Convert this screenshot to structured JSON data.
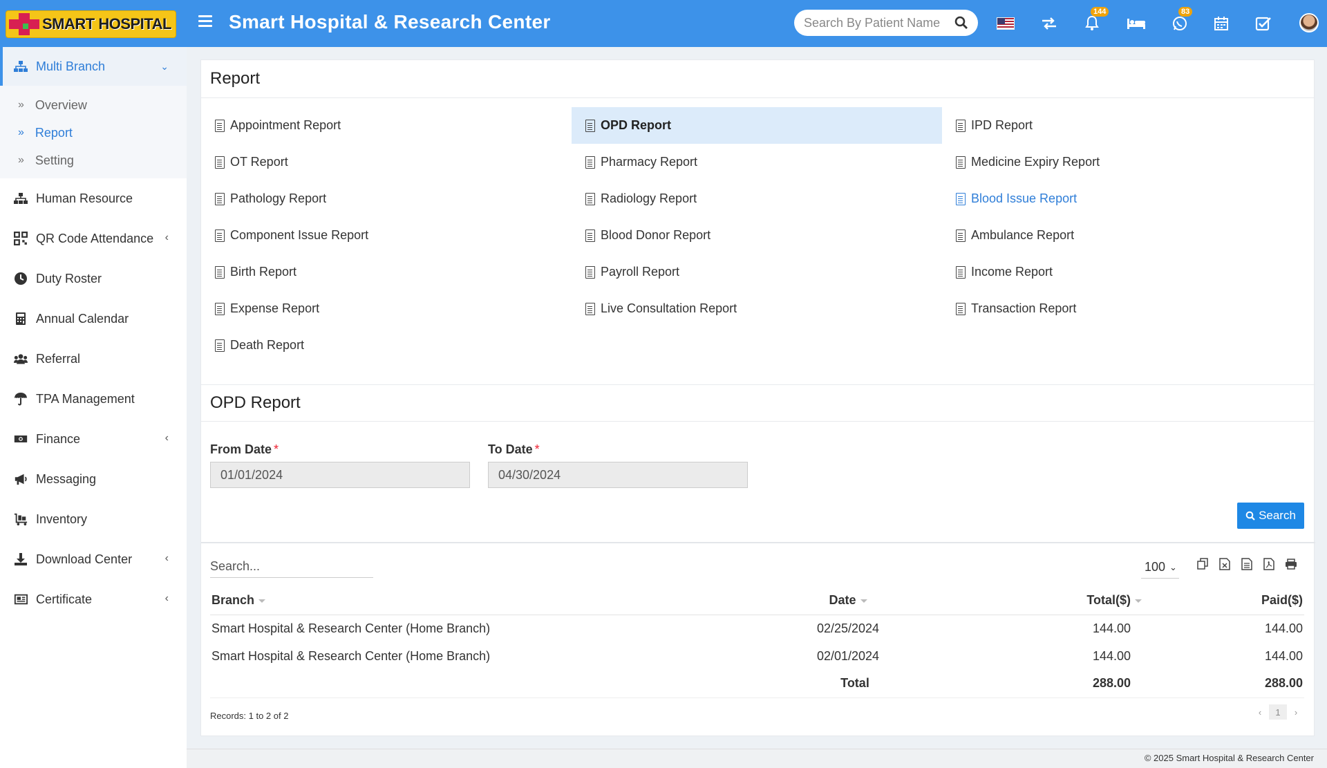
{
  "header": {
    "logo_text": "SMART HOSPITAL",
    "title": "Smart Hospital & Research Center",
    "search_placeholder": "Search By Patient Name",
    "notifications_count": "144",
    "whatsapp_count": "83"
  },
  "sidebar": {
    "active_group": "Multi Branch",
    "sub_items": [
      {
        "label": "Overview"
      },
      {
        "label": "Report"
      },
      {
        "label": "Setting"
      }
    ],
    "items": [
      {
        "label": "Human Resource"
      },
      {
        "label": "QR Code Attendance"
      },
      {
        "label": "Duty Roster"
      },
      {
        "label": "Annual Calendar"
      },
      {
        "label": "Referral"
      },
      {
        "label": "TPA Management"
      },
      {
        "label": "Finance"
      },
      {
        "label": "Messaging"
      },
      {
        "label": "Inventory"
      },
      {
        "label": "Download Center"
      },
      {
        "label": "Certificate"
      }
    ]
  },
  "main": {
    "title": "Report",
    "reports": [
      "Appointment Report",
      "OPD Report",
      "IPD Report",
      "OT Report",
      "Pharmacy Report",
      "Medicine Expiry Report",
      "Pathology Report",
      "Radiology Report",
      "Blood Issue Report",
      "Component Issue Report",
      "Blood Donor Report",
      "Ambulance Report",
      "Birth Report",
      "Payroll Report",
      "Income Report",
      "Expense Report",
      "Live Consultation Report",
      "Transaction Report",
      "Death Report"
    ],
    "active_report": "OPD Report",
    "section_title": "OPD Report",
    "from_date_label": "From Date",
    "from_date": "01/01/2024",
    "to_date_label": "To Date",
    "to_date": "04/30/2024",
    "search_button": "Search"
  },
  "table": {
    "search_placeholder": "Search...",
    "page_size": "100",
    "headers": [
      "Branch",
      "Date",
      "Total($)",
      "Paid($)"
    ],
    "rows": [
      [
        "Smart Hospital & Research Center (Home Branch)",
        "02/25/2024",
        "144.00",
        "144.00"
      ],
      [
        "Smart Hospital & Research Center (Home Branch)",
        "02/01/2024",
        "144.00",
        "144.00"
      ]
    ],
    "total_label": "Total",
    "total_total": "288.00",
    "total_paid": "288.00",
    "records_info": "Records: 1 to 2 of 2",
    "current_page": "1"
  },
  "footer": {
    "copyright": "© 2025 Smart Hospital & Research Center"
  },
  "colors": {
    "primary": "#3d92e9",
    "button": "#1e88e5",
    "active_row": "#dcebfa",
    "badge": "#f0a30a"
  }
}
